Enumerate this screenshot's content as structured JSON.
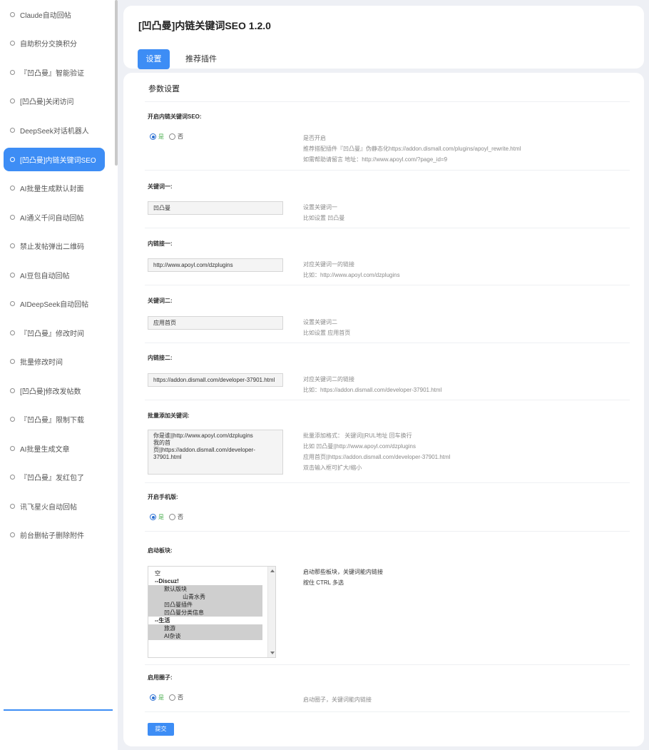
{
  "sidebar": {
    "items": [
      {
        "label": "Claude自动回帖"
      },
      {
        "label": "自助积分交换积分"
      },
      {
        "label": "『凹凸曼』智能验证"
      },
      {
        "label": "[凹凸曼]关闭访问"
      },
      {
        "label": "DeepSeek对话机器人"
      },
      {
        "label": "[凹凸曼]内链关键词SEO",
        "active": true
      },
      {
        "label": "AI批量生成默认封面"
      },
      {
        "label": "AI通义千问自动回帖"
      },
      {
        "label": "禁止发帖弹出二维码"
      },
      {
        "label": "AI豆包自动回帖"
      },
      {
        "label": "AIDeepSeek自动回帖"
      },
      {
        "label": "『凹凸曼』修改时间"
      },
      {
        "label": "批量修改时间"
      },
      {
        "label": "[凹凸曼]修改发帖数"
      },
      {
        "label": "『凹凸曼』限制下载"
      },
      {
        "label": "AI批量生成文章"
      },
      {
        "label": "『凹凸曼』发红包了"
      },
      {
        "label": "讯飞星火自动回帖"
      },
      {
        "label": "前台删帖子删除附件"
      }
    ]
  },
  "header": {
    "title": "[凹凸曼]内链关键词SEO 1.2.0",
    "tabs": [
      {
        "label": "设置",
        "active": true
      },
      {
        "label": "推荐插件"
      }
    ]
  },
  "form": {
    "section_title": "参数设置",
    "enable_seo": {
      "label": "开启内链关键词SEO:",
      "yes": "是",
      "no": "否",
      "selected": "是",
      "desc": [
        "是否开启",
        "推荐搭配插件『凹凸曼』伪静态化https://addon.dismall.com/plugins/apoyl_rewrite.html",
        "如需帮助请留言 地址：http://www.apoyl.com/?page_id=9"
      ]
    },
    "keyword1": {
      "label": "关键词一:",
      "value": "凹凸曼",
      "desc": [
        "设置关键词一",
        "比如设置 凹凸曼"
      ]
    },
    "link1": {
      "label": "内链接一:",
      "value": "http://www.apoyl.com/dzplugins",
      "desc": [
        "对应关键词一的链接",
        "比如：http://www.apoyl.com/dzplugins"
      ]
    },
    "keyword2": {
      "label": "关键词二:",
      "value": "应用首页",
      "desc": [
        "设置关键词二",
        "比如设置 应用首页"
      ]
    },
    "link2": {
      "label": "内链接二:",
      "value": "https://addon.dismall.com/developer-37901.html",
      "desc": [
        "对应关键词二的链接",
        "比如：https://addon.dismall.com/developer-37901.html"
      ]
    },
    "batch": {
      "label": "批量添加关键词:",
      "value": "你是谁||http://www.apoyl.com/dzplugins\n我的首\n页||https://addon.dismall.com/developer-\n37901.html",
      "desc": [
        "批量添加格式： 关键词||RUL地址 回车换行",
        "比如 凹凸曼||http://www.apoyl.com/dzplugins",
        "应用首页||https://addon.dismall.com/developer-37901.html",
        "双击输入框可扩大/缩小"
      ]
    },
    "mobile": {
      "label": "开启手机版:",
      "yes": "是",
      "no": "否",
      "selected": "是"
    },
    "forums": {
      "label": "启动板块:",
      "options": [
        {
          "text": "空",
          "level": 0,
          "selected": false
        },
        {
          "text": "--Discuz!",
          "level": 0,
          "group": true,
          "selected": false
        },
        {
          "text": "默认版块",
          "level": 1,
          "selected": true
        },
        {
          "text": "山青水秀",
          "level": 2,
          "selected": true
        },
        {
          "text": "凹凸曼插件",
          "level": 1,
          "selected": true
        },
        {
          "text": "凹凸曼分类信息",
          "level": 1,
          "selected": true
        },
        {
          "text": "--生活",
          "level": 0,
          "group": true,
          "selected": false
        },
        {
          "text": "旅游",
          "level": 1,
          "selected": true
        },
        {
          "text": "AI杂谈",
          "level": 1,
          "selected": true
        }
      ],
      "desc": [
        "启动那些板块，关键词能内链接",
        "按住 CTRL 多选"
      ]
    },
    "circle": {
      "label": "启用圈子:",
      "yes": "是",
      "no": "否",
      "selected": "是",
      "desc": [
        "启动圈子，关键词能内链接"
      ]
    },
    "submit_label": "提交"
  },
  "colors": {
    "accent": "#3d8df5",
    "yes_green": "#4caf50"
  }
}
